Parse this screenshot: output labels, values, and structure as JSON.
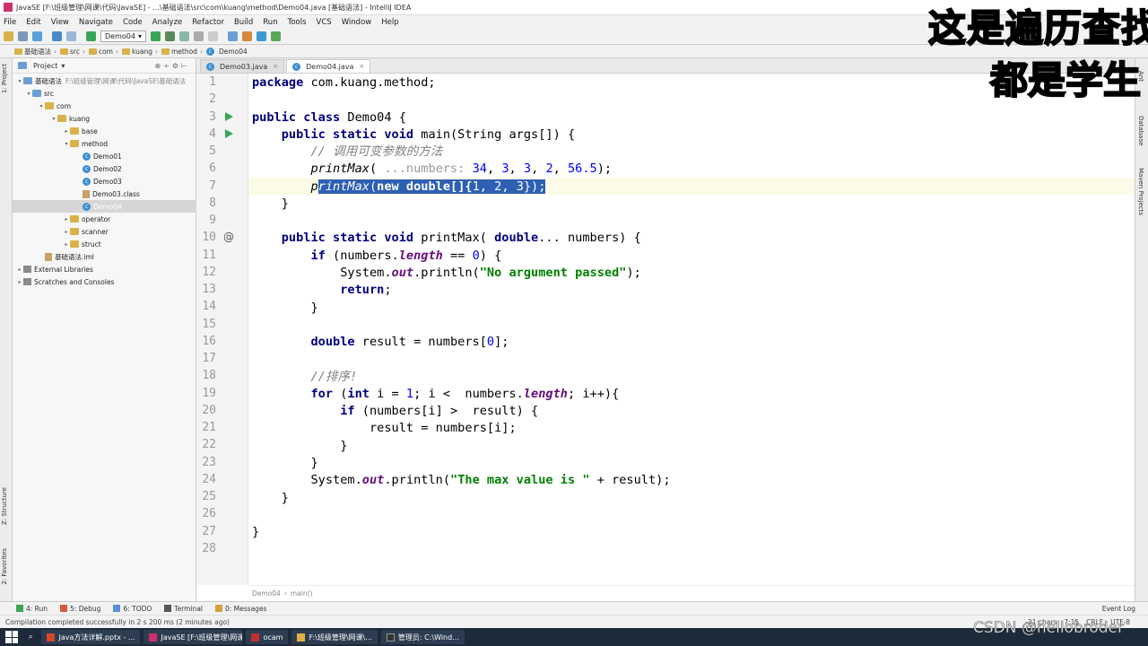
{
  "window": {
    "title": "JavaSE [F:\\班级管理\\网课\\代码\\JavaSE] - ...\\基础语法\\src\\com\\kuang\\method\\Demo04.java [基础语法] - IntelliJ IDEA"
  },
  "menu": [
    "File",
    "Edit",
    "View",
    "Navigate",
    "Code",
    "Analyze",
    "Refactor",
    "Build",
    "Run",
    "Tools",
    "VCS",
    "Window",
    "Help"
  ],
  "toolbar": {
    "run_config": "Demo04"
  },
  "navbar": {
    "crumbs": [
      "基础语法",
      "src",
      "com",
      "kuang",
      "method",
      "Demo04"
    ]
  },
  "project_panel": {
    "title": "Project",
    "tree": [
      {
        "label": "基础语法",
        "hint": "F:\\班级管理\\网课\\代码\\JavaSE\\基础语法",
        "icon": "module-folder-icon",
        "arrow": "▾"
      },
      {
        "label": "src",
        "icon": "source-folder-icon",
        "arrow": "▾"
      },
      {
        "label": "com",
        "icon": "package-folder-icon",
        "arrow": "▾"
      },
      {
        "label": "kuang",
        "icon": "package-folder-icon",
        "arrow": "▾"
      },
      {
        "label": "base",
        "icon": "package-folder-icon",
        "arrow": "▸"
      },
      {
        "label": "method",
        "icon": "package-folder-icon",
        "arrow": "▾"
      },
      {
        "label": "Demo01",
        "icon": "java-class-icon",
        "arrow": ""
      },
      {
        "label": "Demo02",
        "icon": "java-class-icon",
        "arrow": ""
      },
      {
        "label": "Demo03",
        "icon": "java-class-icon",
        "arrow": ""
      },
      {
        "label": "Demo03.class",
        "icon": "class-file-icon",
        "arrow": ""
      },
      {
        "label": "Demo04",
        "icon": "java-class-icon",
        "arrow": "",
        "selected": true
      },
      {
        "label": "operator",
        "icon": "package-folder-icon",
        "arrow": "▸"
      },
      {
        "label": "scanner",
        "icon": "package-folder-icon",
        "arrow": "▸"
      },
      {
        "label": "struct",
        "icon": "package-folder-icon",
        "arrow": "▸"
      },
      {
        "label": "基础语法.iml",
        "icon": "iml-file-icon",
        "arrow": ""
      },
      {
        "label": "External Libraries",
        "icon": "library-icon",
        "arrow": "▸"
      },
      {
        "label": "Scratches and Consoles",
        "icon": "scratch-icon",
        "arrow": "▸"
      }
    ]
  },
  "tabs": [
    {
      "label": "Demo03.java",
      "active": false
    },
    {
      "label": "Demo04.java",
      "active": true
    }
  ],
  "code": {
    "line_numbers": [
      "1",
      "2",
      "3",
      "4",
      "5",
      "6",
      "7",
      "8",
      "9",
      "10",
      "11",
      "12",
      "13",
      "14",
      "15",
      "16",
      "17",
      "18",
      "19",
      "20",
      "21",
      "22",
      "23",
      "24",
      "25",
      "26",
      "27",
      "28"
    ],
    "tokens": {
      "l1_kw": "package",
      "l1_rest": " com.kuang.method;",
      "l3_kw": "public class",
      "l3_rest": " Demo04 {",
      "l4_kw": "public static void",
      "l4_rest": " main(String args[]) {",
      "l5_cm": "// 调用可变参数的方法",
      "l6_fn": "printMax",
      "l6_open": "( ",
      "l6_hint": "...numbers:",
      "l6_n1": "34",
      "l6_n2": "3",
      "l6_n3": "3",
      "l6_n4": "2",
      "l6_n5": "56.5",
      "l6_close": ");",
      "l7_p": "p",
      "l7_fn": "rintMax",
      "l7_open": "(",
      "l7_kw": "new",
      "l7_mid": " double[]{",
      "l7_n1": "1",
      "l7_n2": "2",
      "l7_n3": "3",
      "l7_end": "});",
      "l8": "}",
      "l10_kw": "public static void",
      "l10_fn": " printMax",
      "l10_open": "( ",
      "l10_kw2": "double",
      "l10_rest": "... numbers) {",
      "l11_kw": "if",
      "l11_a": " (numbers.",
      "l11_fld": "length",
      "l11_b": " == ",
      "l11_n": "0",
      "l11_c": ") {",
      "l12_a": "System.",
      "l12_fld": "out",
      "l12_b": ".println(",
      "l12_str": "\"No argument passed\"",
      "l12_c": ");",
      "l13_kw": "return",
      "l13_rest": ";",
      "l14": "}",
      "l16_kw": "double",
      "l16_a": " result = numbers[",
      "l16_n": "0",
      "l16_b": "];",
      "l18_cm": "//排序!",
      "l19_kw": "for",
      "l19_a": " (",
      "l19_kw2": "int",
      "l19_b": " i = ",
      "l19_n": "1",
      "l19_c": "; i <  numbers.",
      "l19_fld": "length",
      "l19_d": "; i++){",
      "l20_kw": "if",
      "l20_rest": " (numbers[i] >  result) {",
      "l21": "result = numbers[i];",
      "l22": "}",
      "l23": "}",
      "l24_a": "System.",
      "l24_fld": "out",
      "l24_b": ".println(",
      "l24_str": "\"The max value is \"",
      "l24_c": " + result);",
      "l25": "}",
      "l27": "}"
    }
  },
  "editor_breadcrumb": [
    "Demo04",
    "main()"
  ],
  "tool_windows": [
    {
      "label": "4: Run",
      "color": "#3aa655"
    },
    {
      "label": "5: Debug",
      "color": "#d25a3c"
    },
    {
      "label": "6: TODO",
      "color": "#5a8fd2"
    },
    {
      "label": "Terminal",
      "color": "#555555"
    },
    {
      "label": "0: Messages",
      "color": "#d2a03c"
    }
  ],
  "event_log": "Event Log",
  "status": {
    "message": "Compilation completed successfully in 2 s 200 ms (2 minutes ago)",
    "chars": "31 chars",
    "position": "7:15",
    "line_sep": "CRLF",
    "encoding": "UTF-8"
  },
  "left_strip": [
    "1: Project",
    "Z: Structure",
    "2: Favorites"
  ],
  "right_strip": [
    "Ant",
    "Database",
    "Maven Projects"
  ],
  "taskbar": {
    "tasks": [
      {
        "label": "Java方法详解.pptx - ...",
        "color": "#d24726"
      },
      {
        "label": "JavaSE [F:\\班级管理\\网课\\...",
        "color": "#d0306e"
      },
      {
        "label": "ocam",
        "color": "#c03030"
      },
      {
        "label": "F:\\班级管理\\网课\\...",
        "color": "#e0b040"
      },
      {
        "label": "管理员: C:\\Wind...",
        "color": "#333333"
      }
    ]
  },
  "overlays": {
    "line1": "这是遍历查找",
    "line2": "都是学生"
  },
  "watermark": "CSDN @hellobroder",
  "colors": {
    "keyword": "#000080",
    "string": "#008000",
    "number": "#0000ff",
    "comment": "#808080",
    "selection": "#2e5fb3"
  }
}
